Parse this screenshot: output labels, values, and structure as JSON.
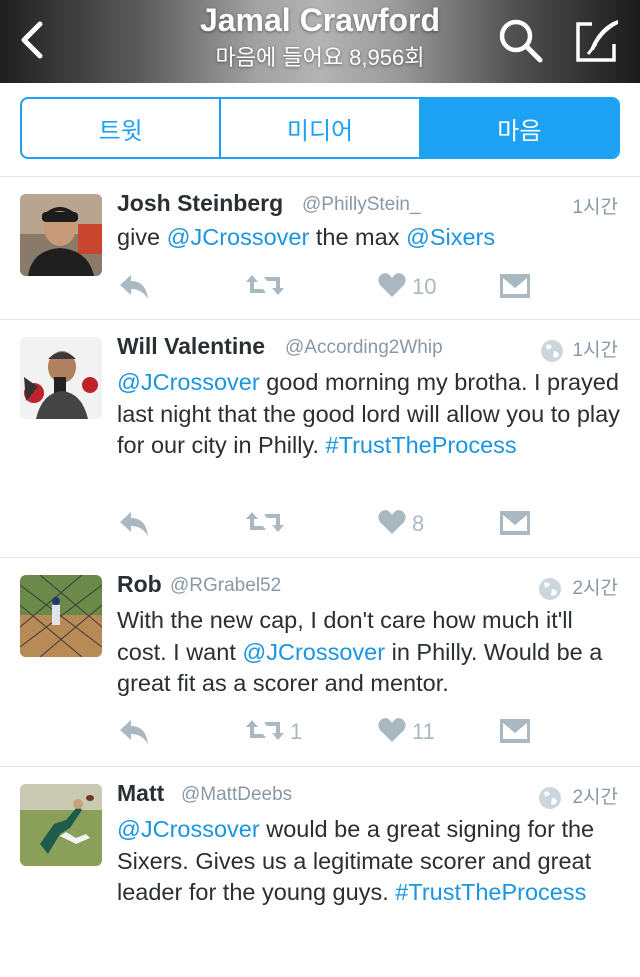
{
  "header": {
    "title": "Jamal Crawford",
    "subtitle": "마음에 들어요 8,956회",
    "icons": [
      "back-chevron-icon",
      "search-icon",
      "compose-icon"
    ]
  },
  "tabs": [
    {
      "label": "트윗",
      "active": false
    },
    {
      "label": "미디어",
      "active": false
    },
    {
      "label": "마음",
      "active": true
    }
  ],
  "colors": {
    "accent": "#1da1f2",
    "link": "#1b95e0",
    "muted": "#8899a6",
    "icon": "#aab8c2"
  },
  "tweets": [
    {
      "name": "Josh Steinberg",
      "handle": "@PhillyStein_",
      "time": "1시간",
      "geo": false,
      "segments": [
        {
          "text": "give ",
          "link": false
        },
        {
          "text": "@JCrossover",
          "link": true
        },
        {
          "text": " the max ",
          "link": false
        },
        {
          "text": "@Sixers",
          "link": true
        }
      ],
      "retweets": "",
      "likes": "10"
    },
    {
      "name": "Will Valentine",
      "handle": "@According2Whip",
      "time": "1시간",
      "geo": true,
      "segments": [
        {
          "text": "@JCrossover",
          "link": true
        },
        {
          "text": " good morning my brotha. I prayed last night that the good lord will allow you to play for our city in Philly. ",
          "link": false
        },
        {
          "text": "#TrustTheProcess",
          "link": true
        }
      ],
      "retweets": "",
      "likes": "8"
    },
    {
      "name": "Rob",
      "handle": "@RGrabel52",
      "time": "2시간",
      "geo": true,
      "segments": [
        {
          "text": "With the new cap, I don't care how much it'll cost. I want ",
          "link": false
        },
        {
          "text": "@JCrossover",
          "link": true
        },
        {
          "text": " in Philly. Would be a great fit as a scorer and mentor.",
          "link": false
        }
      ],
      "retweets": "1",
      "likes": "11"
    },
    {
      "name": "Matt",
      "handle": "@MattDeebs",
      "time": "2시간",
      "geo": true,
      "segments": [
        {
          "text": "@JCrossover",
          "link": true
        },
        {
          "text": " would be a great signing for the Sixers. Gives us a legitimate scorer and great leader for the young guys. ",
          "link": false
        },
        {
          "text": "#TrustTheProcess",
          "link": true
        }
      ],
      "retweets": "",
      "likes": ""
    }
  ]
}
